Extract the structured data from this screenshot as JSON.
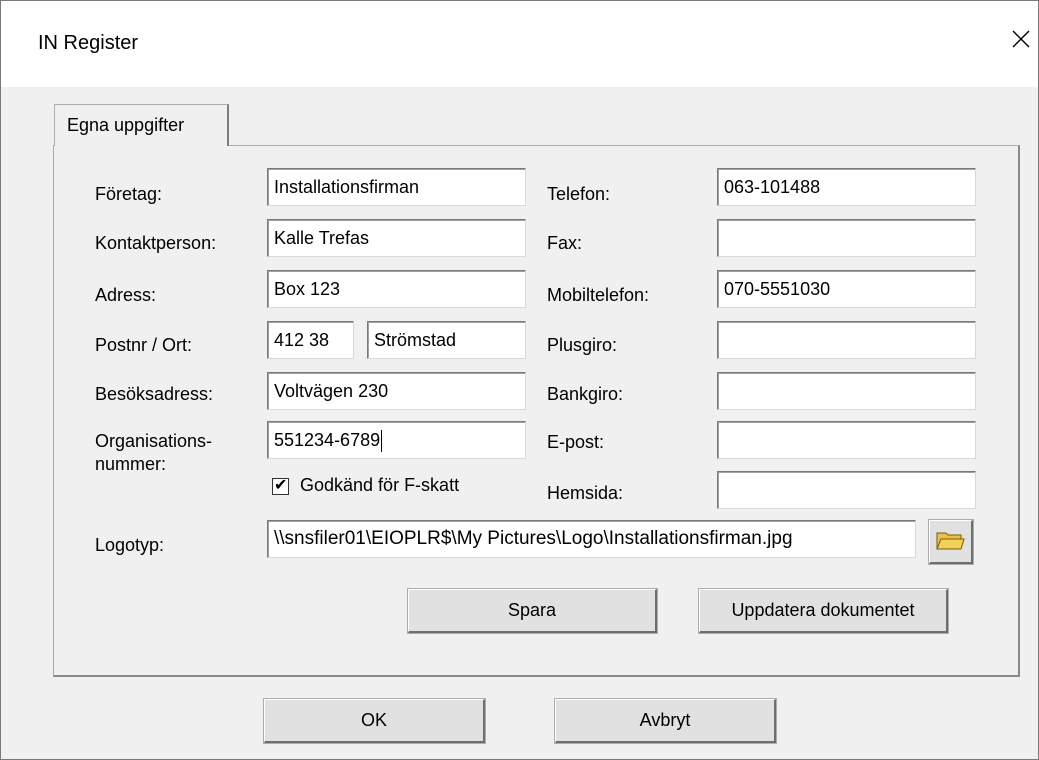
{
  "window": {
    "title": "IN Register"
  },
  "tabs": [
    {
      "label": "Egna uppgifter",
      "selected": true
    }
  ],
  "form": {
    "left": [
      {
        "label": "Företag:",
        "value": "Installationsfirman"
      },
      {
        "label": "Kontaktperson:",
        "value": "Kalle Trefas"
      },
      {
        "label": "Adress:",
        "value": "Box 123"
      },
      {
        "label": "Postnr / Ort:",
        "postnr": "412 38",
        "ort": "Strömstad"
      },
      {
        "label": "Besöksadress:",
        "value": "Voltvägen 230"
      },
      {
        "label_line1": "Organisations-",
        "label_line2": "nummer:",
        "value": "551234-6789"
      }
    ],
    "right": [
      {
        "label": "Telefon:",
        "value": "063-101488"
      },
      {
        "label": "Fax:",
        "value": ""
      },
      {
        "label": "Mobiltelefon:",
        "value": "070-5551030"
      },
      {
        "label": "Plusgiro:",
        "value": ""
      },
      {
        "label": "Bankgiro:",
        "value": ""
      },
      {
        "label": "E-post:",
        "value": ""
      },
      {
        "label": "Hemsida:",
        "value": ""
      }
    ],
    "fskatt": {
      "label": "Godkänd för F-skatt",
      "checked": true,
      "mark": "✔"
    },
    "logo": {
      "label": "Logotyp:",
      "value": "\\\\snsfiler01\\EIOPLR$\\My Pictures\\Logo\\Installationsfirman.jpg",
      "browse_icon": "folder-open-icon"
    }
  },
  "buttons": {
    "save": "Spara",
    "update_document": "Uppdatera dokumentet",
    "ok": "OK",
    "cancel": "Avbryt"
  },
  "colors": {
    "folder": "#f2d15a",
    "folder_outline": "#7a5c00"
  }
}
